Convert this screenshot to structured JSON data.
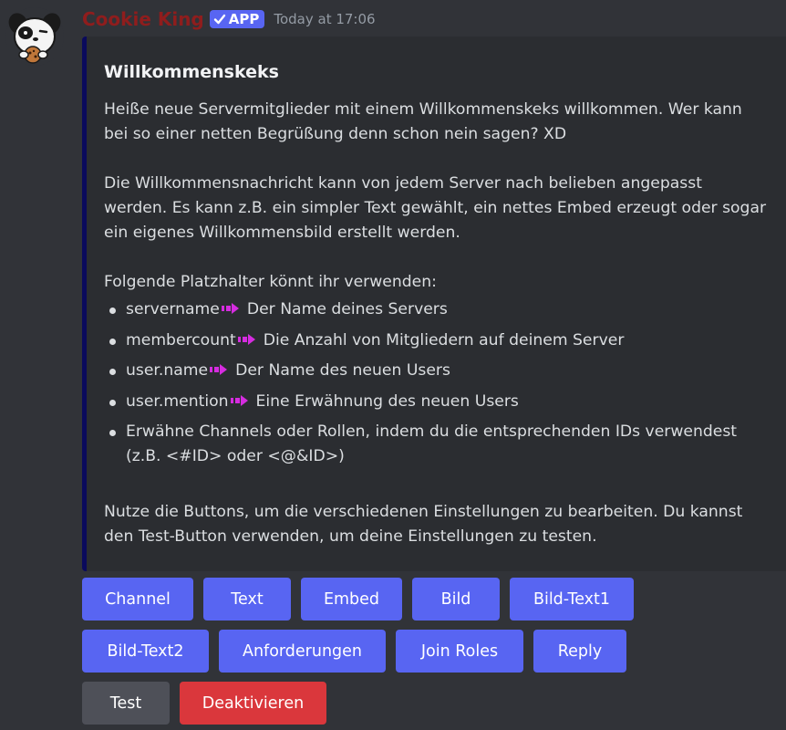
{
  "message": {
    "username": "Cookie King",
    "badge_label": "APP",
    "timestamp": "Today at 17:06"
  },
  "embed": {
    "title": "Willkommenskeks",
    "intro": "Heiße neue Servermitglieder mit einem Willkommenskeks willkommen. Wer kann bei so einer netten Begrüßung denn schon nein sagen? XD",
    "customize": "Die Willkommensnachricht kann von jedem Server nach belieben angepasst werden. Es kann z.B. ein simpler Text gewählt, ein nettes Embed erzeugt oder sogar ein eigenes Willkommensbild erstellt werden.",
    "placeholders_heading": "Folgende Platzhalter könnt ihr verwenden:",
    "placeholders": [
      {
        "key": "servername",
        "desc": "Der Name deines Servers"
      },
      {
        "key": "membercount",
        "desc": "Die Anzahl von Mitgliedern auf deinem Server"
      },
      {
        "key": "user.name",
        "desc": "Der Name des neuen Users"
      },
      {
        "key": "user.mention",
        "desc": "Eine Erwähnung des neuen Users"
      }
    ],
    "channels_note": "Erwähne Channels oder Rollen, indem du die entsprechenden IDs verwendest (z.B. <#ID> oder <@&ID>)",
    "footer_text": "Nutze die Buttons, um die verschiedenen Einstellungen zu bearbeiten. Du kannst den Test-Button verwenden, um deine Einstellungen zu testen."
  },
  "buttons": {
    "channel": "Channel",
    "text": "Text",
    "embed": "Embed",
    "bild": "Bild",
    "bild_text1": "Bild-Text1",
    "bild_text2": "Bild-Text2",
    "anforderungen": "Anforderungen",
    "join_roles": "Join Roles",
    "reply": "Reply",
    "test": "Test",
    "deaktivieren": "Deaktivieren"
  },
  "colors": {
    "background": "#313338",
    "embed_background": "#2b2d31",
    "embed_accent": "#0a0a5c",
    "username": "#8f1d1d",
    "primary_button": "#5865f2",
    "secondary_button": "#4e5058",
    "danger_button": "#da373c",
    "arrow_emoji": "#d62ce0"
  }
}
